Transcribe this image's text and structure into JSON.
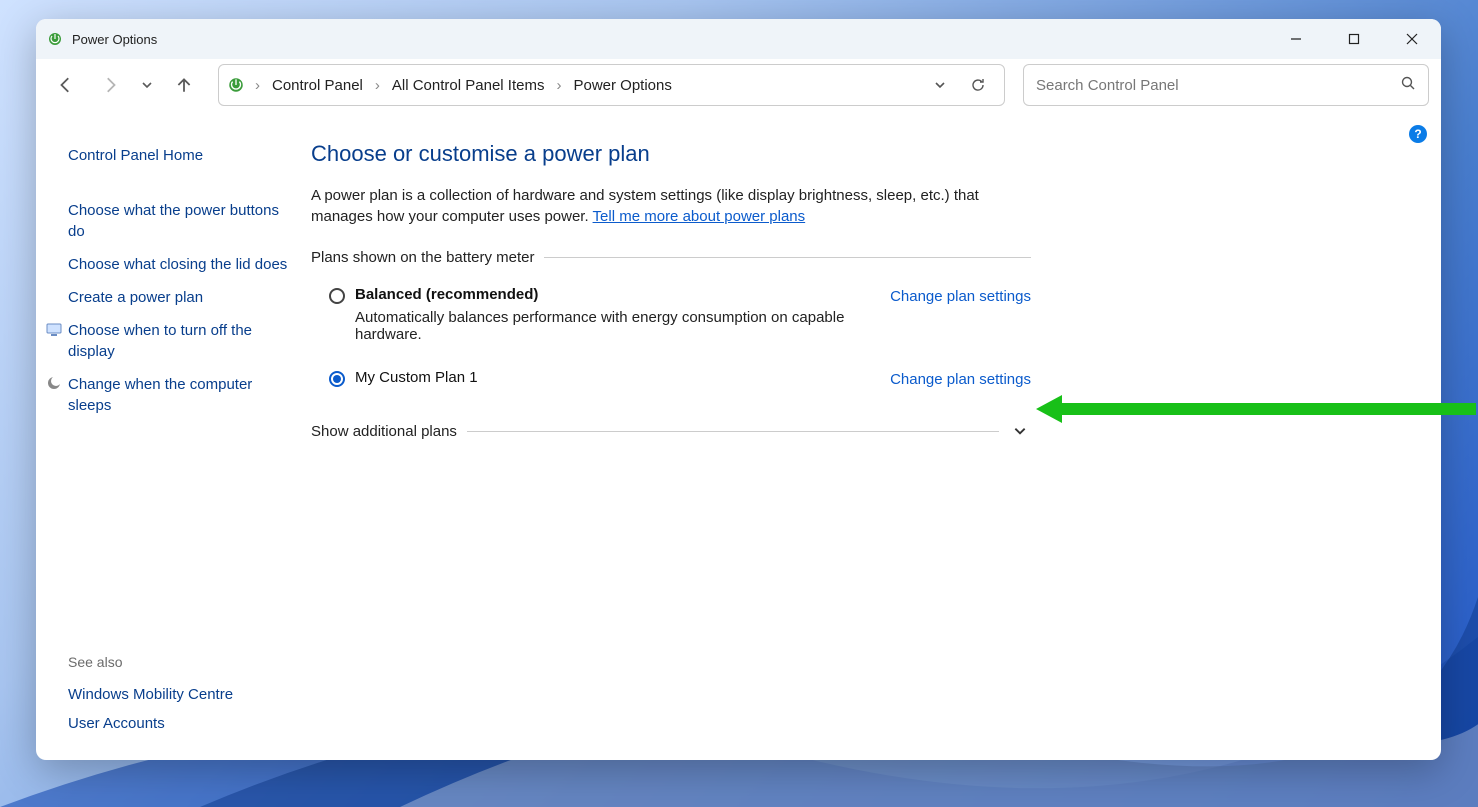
{
  "titlebar": {
    "title": "Power Options"
  },
  "breadcrumb": {
    "items": [
      "Control Panel",
      "All Control Panel Items",
      "Power Options"
    ]
  },
  "search": {
    "placeholder": "Search Control Panel"
  },
  "sidebar": {
    "home": "Control Panel Home",
    "links": [
      "Choose what the power buttons do",
      "Choose what closing the lid does",
      "Create a power plan",
      "Choose when to turn off the display",
      "Change when the computer sleeps"
    ],
    "see_also_label": "See also",
    "see_also": [
      "Windows Mobility Centre",
      "User Accounts"
    ]
  },
  "main": {
    "heading": "Choose or customise a power plan",
    "desc_prefix": "A power plan is a collection of hardware and system settings (like display brightness, sleep, etc.) that manages how your computer uses power. ",
    "desc_link": "Tell me more about power plans",
    "section_plans_shown": "Plans shown on the battery meter",
    "section_additional": "Show additional plans",
    "change_link": "Change plan settings",
    "plans": [
      {
        "name": "Balanced (recommended)",
        "desc": "Automatically balances performance with energy consumption on capable hardware.",
        "selected": false,
        "bold": true
      },
      {
        "name": "My Custom Plan 1",
        "desc": "",
        "selected": true,
        "bold": false
      }
    ]
  }
}
